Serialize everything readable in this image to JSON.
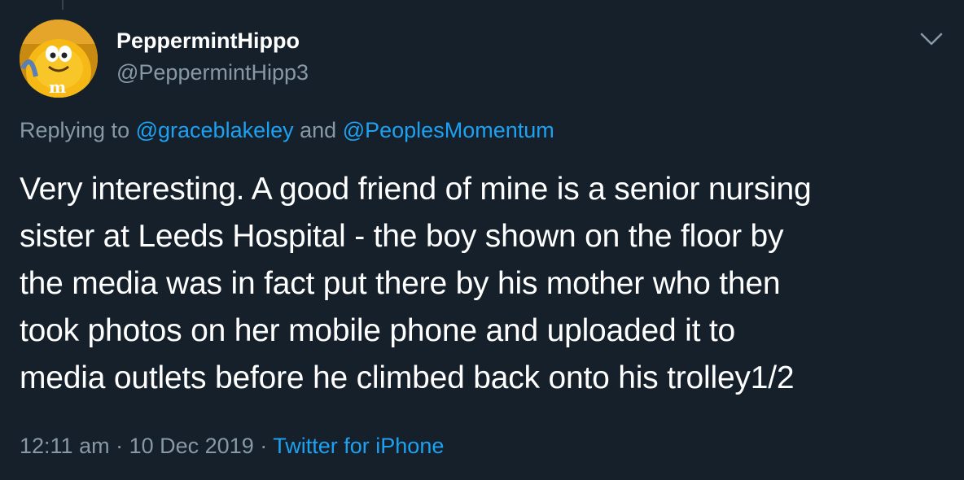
{
  "user": {
    "display_name": "PeppermintHippo",
    "handle": "@PeppermintHipp3",
    "avatar_icon": "mm-character-avatar"
  },
  "reply": {
    "prefix": "Replying to",
    "mention_1": "@graceblakeley",
    "conjunction": "and",
    "mention_2": "@PeoplesMomentum"
  },
  "tweet": {
    "lines": [
      "Very interesting. A good friend of mine is a senior nursing",
      "sister at Leeds Hospital - the boy shown on the floor by",
      "the media was in fact put there by his mother who then",
      "took photos on her mobile phone and uploaded it to",
      "media outlets before he climbed back onto his trolley1/2"
    ]
  },
  "meta": {
    "time": "12:11 am",
    "separator_1": "·",
    "date": "10 Dec 2019",
    "separator_2": "·",
    "source": "Twitter for iPhone"
  },
  "colors": {
    "background": "#15202b",
    "text": "#ffffff",
    "secondary": "#8899a6",
    "accent": "#1da1f2"
  }
}
